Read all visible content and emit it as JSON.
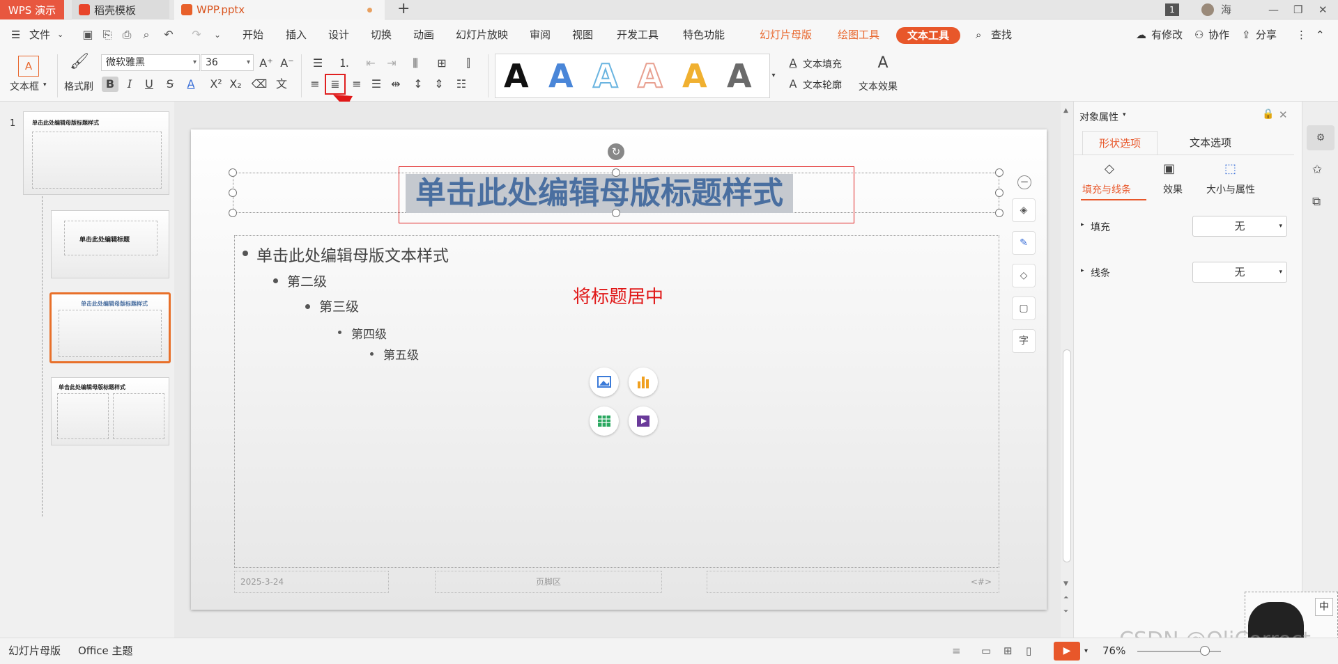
{
  "titlebar": {
    "app_tab": "WPS 演示",
    "template_tab": "稻壳模板",
    "file_tab": "WPP.pptx",
    "new_tab": "+",
    "badge": "1",
    "user": "海"
  },
  "menu": {
    "file": "文件",
    "items": [
      "开始",
      "插入",
      "设计",
      "切换",
      "动画",
      "幻灯片放映",
      "审阅",
      "视图",
      "开发工具",
      "特色功能"
    ],
    "context_tabs": [
      "幻灯片母版",
      "绘图工具"
    ],
    "active_tab": "文本工具",
    "search": "查找",
    "modified": "有修改",
    "collab": "协作",
    "share": "分享"
  },
  "ribbon": {
    "textbox_label": "文本框",
    "format_painter": "格式刷",
    "font_name": "微软雅黑",
    "font_size": "36",
    "text_fill": "文本填充",
    "text_outline": "文本轮廓",
    "text_effect": "文本效果",
    "style_colors": [
      "#111111",
      "#4a86d8",
      "#6ab4e0",
      "#e8a090",
      "#f0b030",
      "#6a6a6a"
    ]
  },
  "thumbnails": {
    "index": "1",
    "t1_title": "单击此处编辑母版标题样式",
    "t2_title": "单击此处编辑标题",
    "t3_title": "单击此处编辑母版标题样式",
    "t4_title": "单击此处编辑母版标题样式"
  },
  "slide": {
    "title": "单击此处编辑母版标题样式",
    "levels": [
      "单击此处编辑母版文本样式",
      "第二级",
      "第三级",
      "第四级",
      "第五级"
    ],
    "annotation": "将标题居中",
    "footer_date": "2025-3-24",
    "footer_center": "页脚区",
    "footer_num": "<#>"
  },
  "panel": {
    "title": "对象属性",
    "tab_shape": "形状选项",
    "tab_text": "文本选项",
    "sub_fill": "填充与线条",
    "sub_effect": "效果",
    "sub_size": "大小与属性",
    "fill_label": "填充",
    "fill_value": "无",
    "line_label": "线条",
    "line_value": "无"
  },
  "status": {
    "mode": "幻灯片母版",
    "theme": "Office 主题",
    "zoom": "76%",
    "watermark": "CSDN @OliCorrect",
    "ime": "中"
  }
}
